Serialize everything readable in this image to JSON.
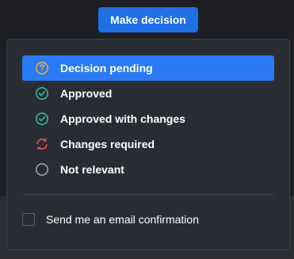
{
  "toolbar": {
    "make_decision_label": "Make decision"
  },
  "decision_menu": {
    "options": [
      {
        "label": "Decision pending",
        "icon": "help-circle-icon",
        "icon_color": "#f0a93a",
        "selected": true
      },
      {
        "label": "Approved",
        "icon": "check-circle-icon",
        "icon_color": "#2dbd8f",
        "selected": false
      },
      {
        "label": "Approved with changes",
        "icon": "check-circle-icon",
        "icon_color": "#2dbd8f",
        "selected": false
      },
      {
        "label": "Changes required",
        "icon": "refresh-arrows-icon",
        "icon_color": "#e5534b",
        "selected": false
      },
      {
        "label": "Not relevant",
        "icon": "empty-circle-icon",
        "icon_color": "#9aa0ab",
        "selected": false
      }
    ],
    "email_confirmation": {
      "label": "Send me an email confirmation",
      "checked": false
    }
  },
  "colors": {
    "accent": "#2b7af5",
    "button": "#1f6fe6",
    "panel": "#2a2c34"
  }
}
